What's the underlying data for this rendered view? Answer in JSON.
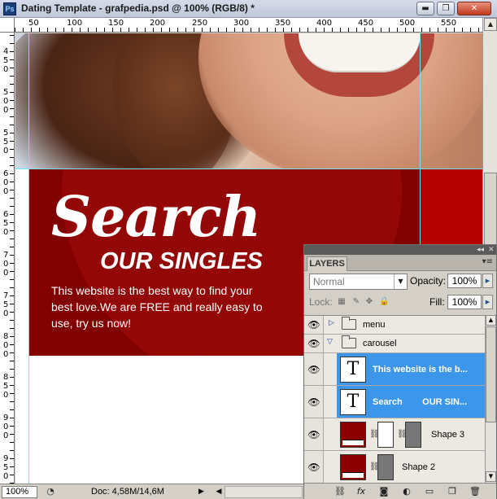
{
  "window": {
    "app_icon": "Ps",
    "title": "Dating Template - grafpedia.psd @ 100% (RGB/8) *",
    "minimize_glyph": "▬",
    "maximize_glyph": "❐",
    "close_glyph": "✕"
  },
  "ruler": {
    "top_labels": [
      "50",
      "100",
      "150",
      "200",
      "250",
      "300",
      "350",
      "400",
      "450",
      "500",
      "550"
    ],
    "left_labels": [
      "4\n5\n0",
      "5\n0\n0",
      "5\n5\n0",
      "6\n0\n0",
      "6\n5\n0",
      "7\n0\n0",
      "7\n5\n0",
      "8\n0\n0",
      "8\n5\n0",
      "9\n0\n0",
      "9\n5\n0"
    ]
  },
  "banner": {
    "headline": "Search",
    "subhead": "OUR SINGLES",
    "body": "This website is the best way to find your best love.We are FREE and really easy to use, try us now!"
  },
  "status": {
    "zoom": "100%",
    "doc_info": "Doc: 4,58M/14,6M"
  },
  "layers_panel": {
    "tab": "LAYERS",
    "blend_mode": "Normal",
    "opacity_label": "Opacity:",
    "opacity_value": "100%",
    "lock_label": "Lock:",
    "fill_label": "Fill:",
    "fill_value": "100%",
    "layers": [
      {
        "name": "menu",
        "kind": "group",
        "expanded": false
      },
      {
        "name": "carousel",
        "kind": "group",
        "expanded": true
      },
      {
        "name": "This website is the b...",
        "kind": "text",
        "selected": true
      },
      {
        "name": "Search        OUR SIN...",
        "kind": "text",
        "selected": true
      },
      {
        "name": "Shape 3",
        "kind": "shape"
      },
      {
        "name": "Shape 2",
        "kind": "shape"
      }
    ]
  },
  "icons": {
    "eye": "👁",
    "link": "⛓",
    "fx": "fx",
    "mask": "◙",
    "adjustment": "◐",
    "group": "▭",
    "new_layer": "❐",
    "trash": "🗑"
  },
  "colors": {
    "banner_red": "#980000",
    "selection_blue": "#3c97ea",
    "guide": "#6ee6f0"
  }
}
